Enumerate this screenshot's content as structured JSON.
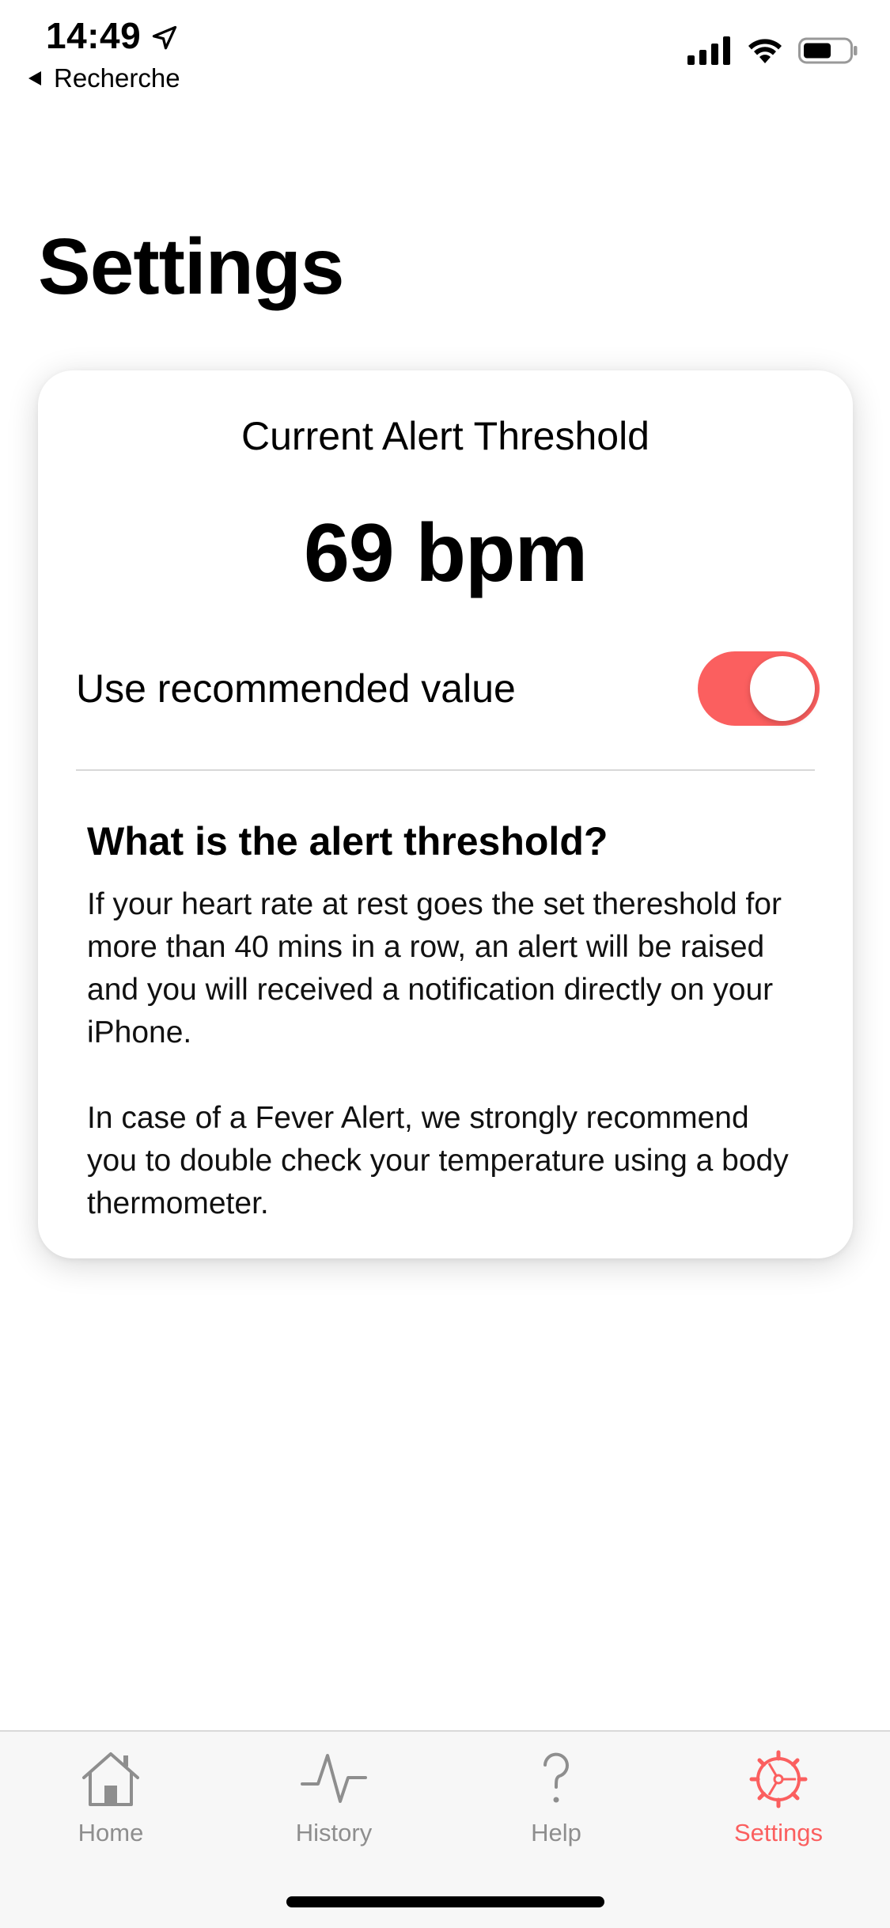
{
  "status_bar": {
    "time": "14:49",
    "back_label": "Recherche",
    "icons": [
      "location-arrow-icon",
      "signal-icon",
      "wifi-icon",
      "battery-icon"
    ]
  },
  "page": {
    "title": "Settings"
  },
  "threshold_card": {
    "title": "Current Alert Threshold",
    "value": "69 bpm",
    "toggle_label": "Use recommended value",
    "toggle_on": true,
    "info_heading": "What is the alert threshold?",
    "info_paragraph_1": "If your heart rate at rest goes the set thereshold for more than 40 mins in a row, an alert will be raised and you will received a notification directly on your iPhone.",
    "info_paragraph_2": "In case of a Fever Alert, we strongly recommend you to double check your temperature using a body thermometer."
  },
  "tab_bar": {
    "tabs": [
      {
        "label": "Home",
        "icon": "house-icon",
        "active": false
      },
      {
        "label": "History",
        "icon": "pulse-icon",
        "active": false
      },
      {
        "label": "Help",
        "icon": "question-icon",
        "active": false
      },
      {
        "label": "Settings",
        "icon": "gear-icon",
        "active": true
      }
    ]
  },
  "colors": {
    "accent": "#fb5f5f",
    "inactive_tab": "#8e8e8e",
    "tab_bar_bg": "#f7f7f7"
  }
}
